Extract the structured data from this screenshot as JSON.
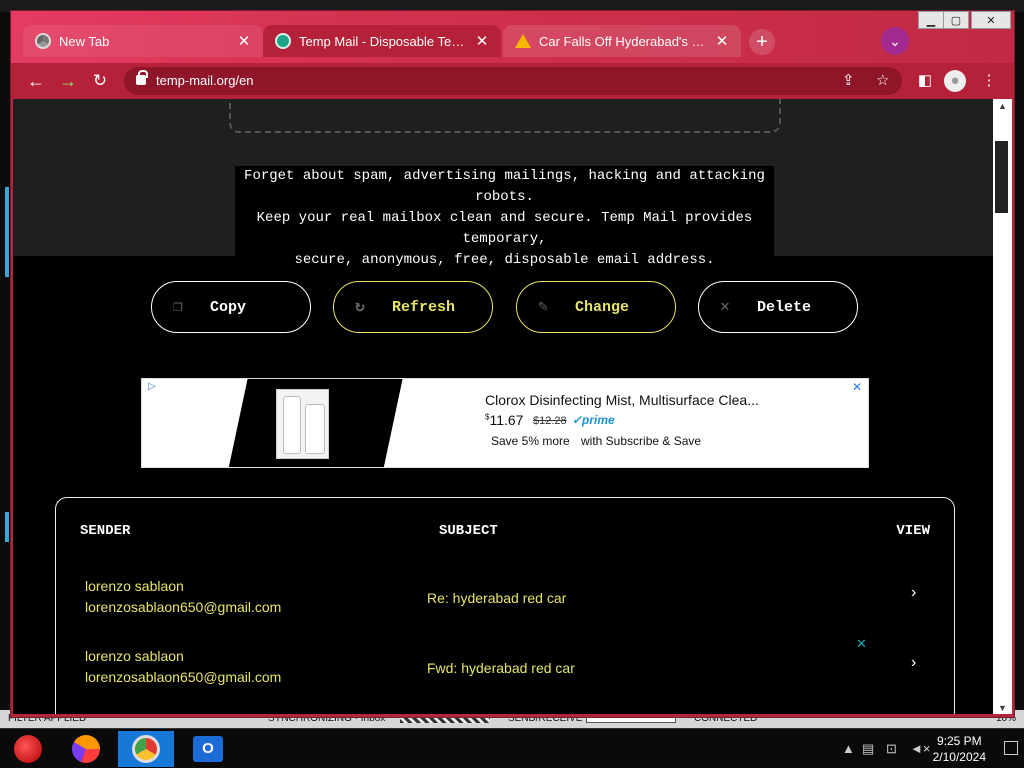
{
  "browser": {
    "tabs": [
      {
        "label": "New Tab"
      },
      {
        "label": "Temp Mail - Disposable Temporary Email"
      },
      {
        "label": "Car Falls Off Hyderabad's Biodiversity Flyover"
      }
    ],
    "new_tab_label": "+",
    "url": "temp-mail.org/en"
  },
  "hero": {
    "tagline_lines": [
      "Forget about spam, advertising mailings, hacking and attacking robots.",
      "Keep your real mailbox clean and secure. Temp Mail provides temporary,",
      "secure, anonymous, free, disposable email address."
    ]
  },
  "actions": {
    "copy": "Copy",
    "refresh": "Refresh",
    "change": "Change",
    "delete": "Delete"
  },
  "ad": {
    "title": "Clorox Disinfecting Mist, Multisurface Clea...",
    "price_sup": "$",
    "price": "11.67",
    "old_price": "$12.28",
    "prime": "✓prime",
    "save": "Save 5% more",
    "subscribe": "with Subscribe & Save"
  },
  "inbox": {
    "headers": {
      "sender": "SENDER",
      "subject": "SUBJECT",
      "view": "VIEW"
    },
    "messages": [
      {
        "sender_name": "lorenzo sablaon",
        "sender_email": "lorenzosablaon650@gmail.com",
        "subject": "Re: hyderabad red car"
      },
      {
        "sender_name": "lorenzo sablaon",
        "sender_email": "lorenzosablaon650@gmail.com",
        "subject": "Fwd: hyderabad red car"
      }
    ]
  },
  "statusbar": {
    "filter": "FILTER APPLIED",
    "sync": "SYNCHRONIZING · Inbox",
    "send": "SEND/RECEIVE",
    "connected": "CONNECTED",
    "zoom": "10%"
  },
  "taskbar": {
    "time": "9:25 PM",
    "date": "2/10/2024"
  },
  "colors": {
    "accent": "#e7e46a",
    "tab_strip": "#d2304f",
    "toolbar": "#b52138"
  }
}
